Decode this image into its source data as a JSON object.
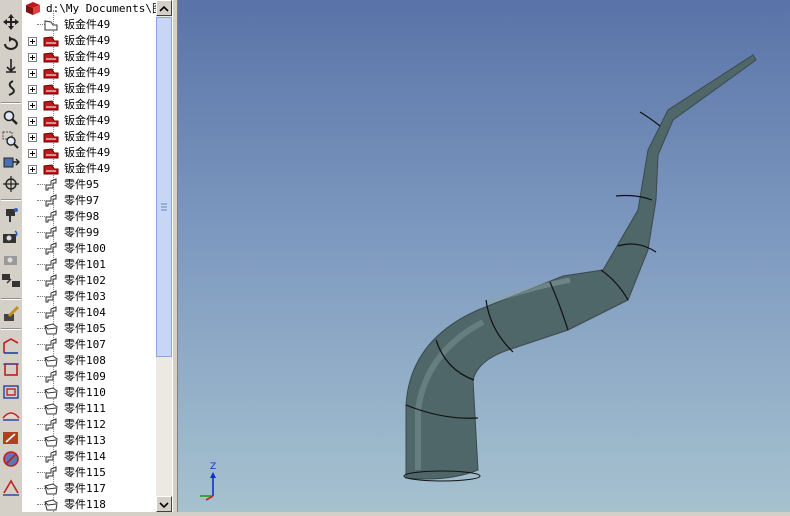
{
  "tree": {
    "root_label": "d:\\My Documents\\图",
    "items": [
      {
        "label": "钣金件49",
        "type": "sheet",
        "expandable": false
      },
      {
        "label": "钣金件49",
        "type": "sheet-red",
        "expandable": true
      },
      {
        "label": "钣金件49",
        "type": "sheet-red",
        "expandable": true
      },
      {
        "label": "钣金件49",
        "type": "sheet-red",
        "expandable": true
      },
      {
        "label": "钣金件49",
        "type": "sheet-red",
        "expandable": true
      },
      {
        "label": "钣金件49",
        "type": "sheet-red",
        "expandable": true
      },
      {
        "label": "钣金件49",
        "type": "sheet-red",
        "expandable": true
      },
      {
        "label": "钣金件49",
        "type": "sheet-red",
        "expandable": true
      },
      {
        "label": "钣金件49",
        "type": "sheet-red",
        "expandable": true
      },
      {
        "label": "钣金件49",
        "type": "sheet-red",
        "expandable": true
      },
      {
        "label": "零件95",
        "type": "part"
      },
      {
        "label": "零件97",
        "type": "part"
      },
      {
        "label": "零件98",
        "type": "part"
      },
      {
        "label": "零件99",
        "type": "part"
      },
      {
        "label": "零件100",
        "type": "part"
      },
      {
        "label": "零件101",
        "type": "part"
      },
      {
        "label": "零件102",
        "type": "part"
      },
      {
        "label": "零件103",
        "type": "part"
      },
      {
        "label": "零件104",
        "type": "part"
      },
      {
        "label": "零件105",
        "type": "part-box"
      },
      {
        "label": "零件107",
        "type": "part"
      },
      {
        "label": "零件108",
        "type": "part-box"
      },
      {
        "label": "零件109",
        "type": "part"
      },
      {
        "label": "零件110",
        "type": "part-box"
      },
      {
        "label": "零件111",
        "type": "part-box"
      },
      {
        "label": "零件112",
        "type": "part"
      },
      {
        "label": "零件113",
        "type": "part-box"
      },
      {
        "label": "零件114",
        "type": "part"
      },
      {
        "label": "零件115",
        "type": "part"
      },
      {
        "label": "零件117",
        "type": "part-box"
      },
      {
        "label": "零件118",
        "type": "part-box"
      }
    ]
  },
  "toolbar": {
    "tools": [
      "move-icon",
      "rotate-icon",
      "walk-icon",
      "path-icon",
      "zoom-icon",
      "zoom-area-icon",
      "view-orient-icon",
      "center-icon",
      "camera-target-icon",
      "camera-icon",
      "camera-disabled-icon",
      "camera-fit-icon",
      "pencil-icon",
      "sketch-icon",
      "rectangle-icon",
      "frame-icon",
      "surface-icon",
      "arrow-icon",
      "circle-slash-icon",
      "measure-icon"
    ]
  },
  "axis": {
    "z_label": "Z"
  },
  "colors": {
    "pipe": "#4f6464",
    "background_top": "#5a73a8",
    "background_bottom": "#a6c2cf",
    "sheet_red": "#c01818"
  }
}
